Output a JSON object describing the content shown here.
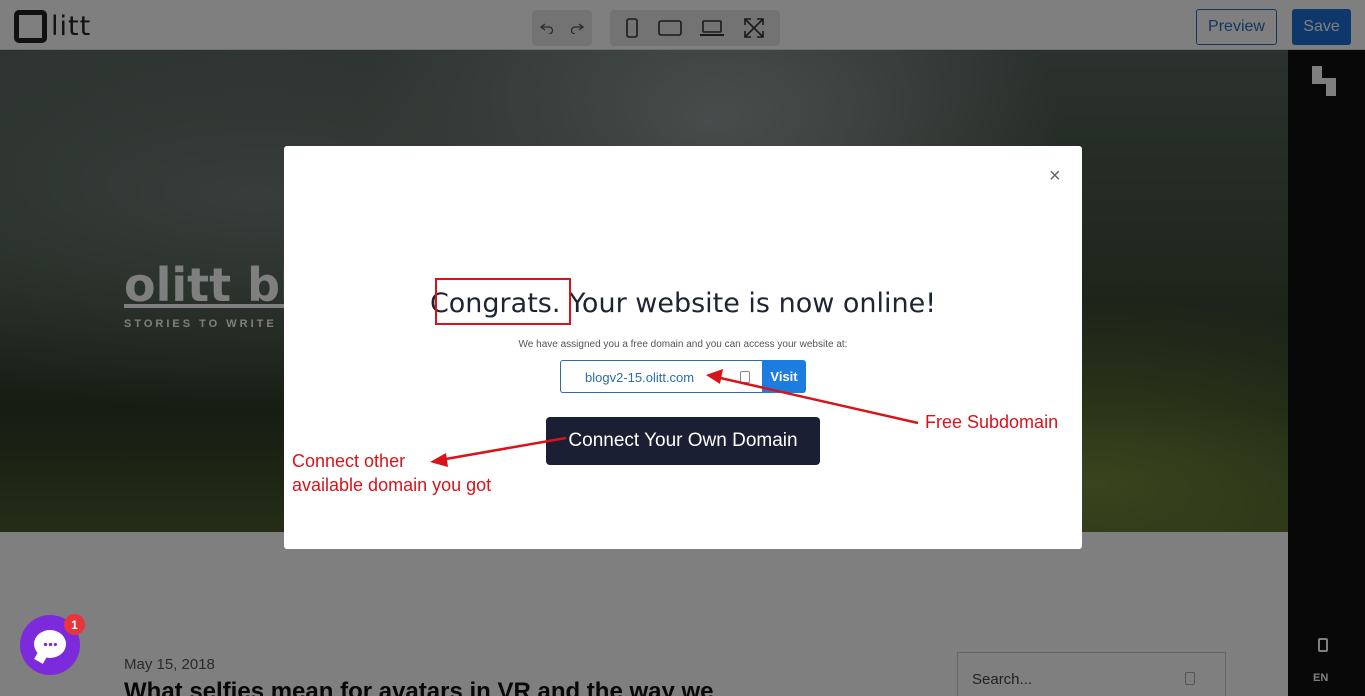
{
  "app": {
    "logo_text": "litt",
    "preview_label": "Preview",
    "save_label": "Save"
  },
  "page": {
    "blog_title": "olitt blo",
    "tagline": "STORIES TO WRITE",
    "post_date": "May 15, 2018",
    "post_title": "What selfies mean for avatars in VR and the way we",
    "search_placeholder": "Search..."
  },
  "panel": {
    "lang": "EN"
  },
  "chat": {
    "badge_count": "1"
  },
  "modal": {
    "close_glyph": "×",
    "headline": "Congrats. Your website is now online!",
    "subtext": "We have assigned you a free domain and you can access your website at:",
    "domain": "blogv2-15.olitt.com",
    "visit_label": "Visit",
    "connect_label": "Connect Your Own Domain"
  },
  "annotations": {
    "free_subdomain": "Free Subdomain",
    "connect_line1": "Connect other",
    "connect_line2": "available domain you got"
  },
  "colors": {
    "accent": "#1d6fd6",
    "annotation": "#d8141b",
    "chat": "#7c2bdc",
    "modal_button": "#1b1f33"
  },
  "icons": {
    "undo": "undo-icon",
    "redo": "redo-icon",
    "mobile": "mobile-device-icon",
    "tablet": "tablet-device-icon",
    "laptop": "laptop-device-icon",
    "fullscreen": "fullscreen-icon",
    "copy": "clipboard-icon"
  }
}
